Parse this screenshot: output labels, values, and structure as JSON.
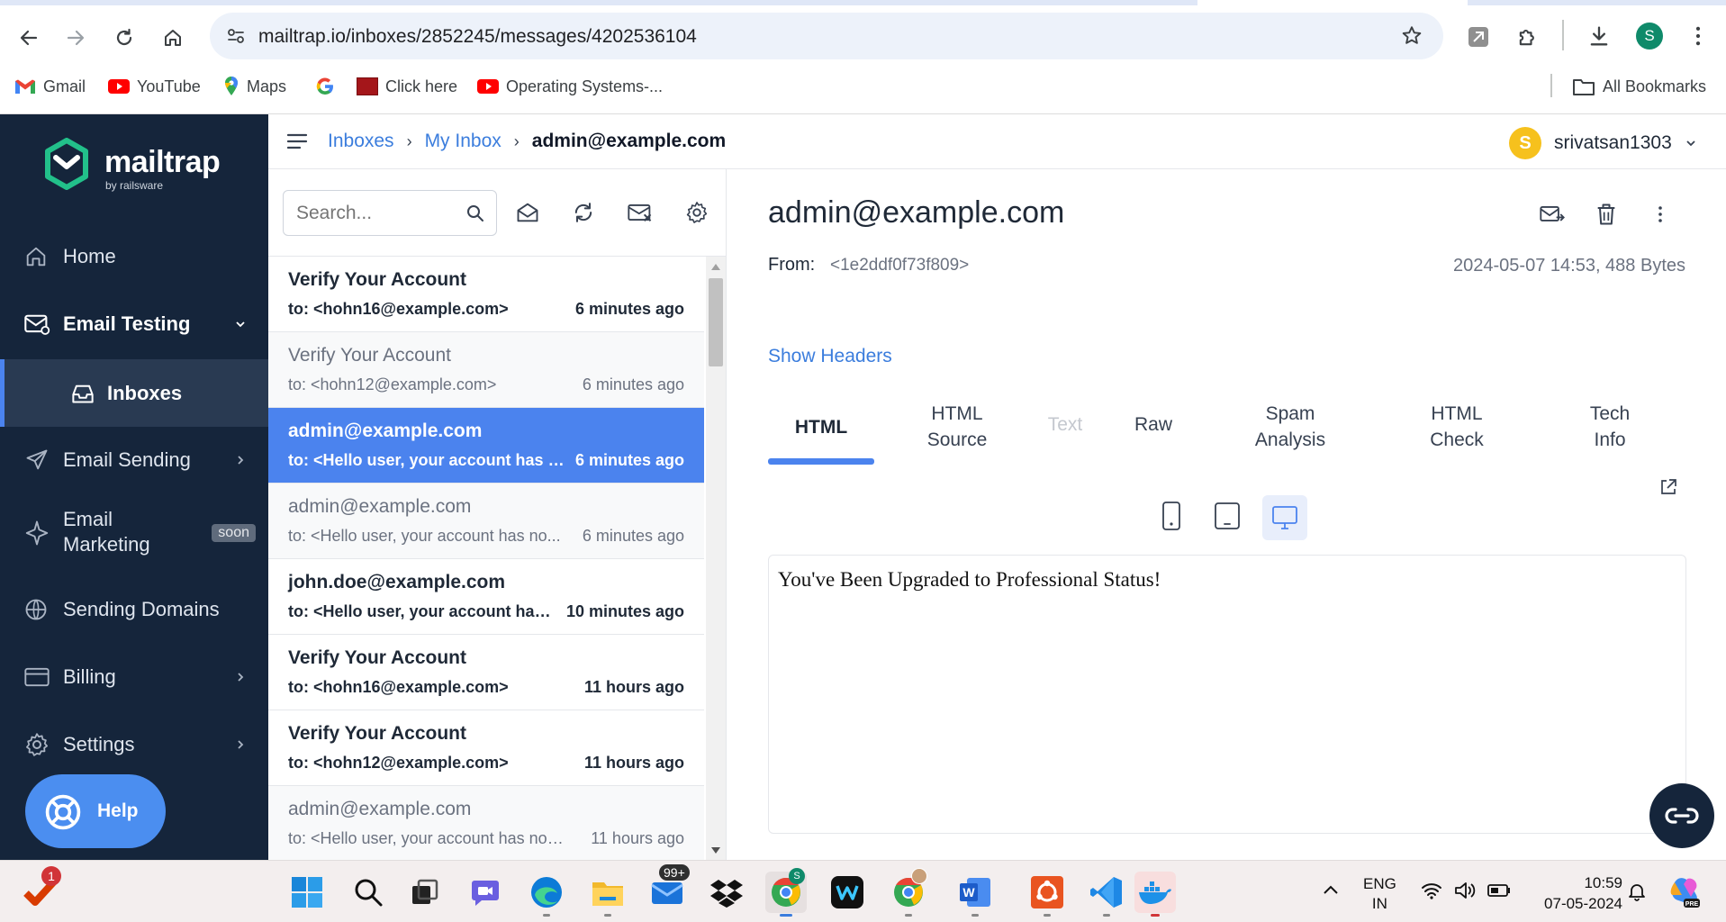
{
  "browser": {
    "url": "mailtrap.io/inboxes/2852245/messages/4202536104",
    "profile_initial": "S",
    "bookmarks": [
      {
        "label": "Gmail"
      },
      {
        "label": "YouTube"
      },
      {
        "label": "Maps"
      },
      {
        "label": ""
      },
      {
        "label": "Click here"
      },
      {
        "label": "Operating Systems-..."
      }
    ],
    "all_bookmarks": "All Bookmarks"
  },
  "app": {
    "logo": "mailtrap",
    "logo_sub": "by railsware",
    "nav": {
      "home": "Home",
      "email_testing": "Email Testing",
      "inboxes": "Inboxes",
      "email_sending": "Email Sending",
      "email_marketing_1": "Email",
      "email_marketing_2": "Marketing",
      "soon_badge": "soon",
      "sending_domains": "Sending Domains",
      "billing": "Billing",
      "settings": "Settings",
      "help": "Help"
    },
    "breadcrumb": {
      "inboxes": "Inboxes",
      "my_inbox": "My Inbox",
      "current": "admin@example.com"
    },
    "user": {
      "initial": "S",
      "name": "srivatsan1303"
    },
    "search_placeholder": "Search...",
    "messages": [
      {
        "subject": "Verify Your Account",
        "to": "to: <hohn16@example.com>",
        "time": "6 minutes ago",
        "state": "unread"
      },
      {
        "subject": "Verify Your Account",
        "to": "to: <hohn12@example.com>",
        "time": "6 minutes ago",
        "state": "read"
      },
      {
        "subject": "admin@example.com",
        "to": "to: <Hello user, your account has no...",
        "time": "6 minutes ago",
        "state": "selected"
      },
      {
        "subject": "admin@example.com",
        "to": "to: <Hello user, your account has no...",
        "time": "6 minutes ago",
        "state": "read"
      },
      {
        "subject": "john.doe@example.com",
        "to": "to: <Hello user, your account has n...",
        "time": "10 minutes ago",
        "state": "unread"
      },
      {
        "subject": "Verify Your Account",
        "to": "to: <hohn16@example.com>",
        "time": "11 hours ago",
        "state": "unread"
      },
      {
        "subject": "Verify Your Account",
        "to": "to: <hohn12@example.com>",
        "time": "11 hours ago",
        "state": "unread"
      },
      {
        "subject": "admin@example.com",
        "to": "to: <Hello user, your account has now ...",
        "time": "11 hours ago",
        "state": "read"
      }
    ],
    "detail": {
      "subject": "admin@example.com",
      "from_label": "From:",
      "from_value": "<1e2ddf0f73f809>",
      "meta": "2024-05-07 14:53, 488 Bytes",
      "show_headers": "Show Headers",
      "tabs": {
        "html": "HTML",
        "html_source_1": "HTML",
        "html_source_2": "Source",
        "text": "Text",
        "raw": "Raw",
        "spam_1": "Spam",
        "spam_2": "Analysis",
        "check_1": "HTML",
        "check_2": "Check",
        "tech_1": "Tech",
        "tech_2": "Info"
      },
      "body": "You've Been Upgraded to Professional Status!"
    }
  },
  "taskbar": {
    "notif_badge": "1",
    "mail_badge": "99+",
    "lang_1": "ENG",
    "lang_2": "IN",
    "time": "10:59",
    "date": "07-05-2024"
  },
  "colors": {
    "sidebar": "#15253b",
    "accent": "#4b83ee",
    "brand_green": "#22c08a"
  }
}
